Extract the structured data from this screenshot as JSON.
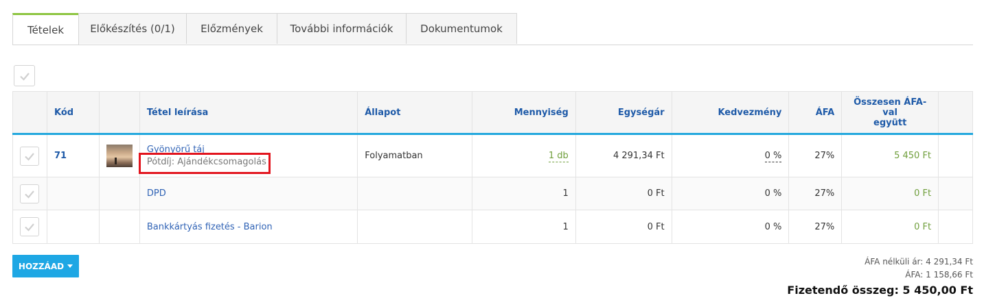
{
  "tabs": [
    {
      "label": "Tételek",
      "active": true
    },
    {
      "label": "Előkészítés (0/1)",
      "active": false
    },
    {
      "label": "Előzmények",
      "active": false
    },
    {
      "label": "További információk",
      "active": false
    },
    {
      "label": "Dokumentumok",
      "active": false
    }
  ],
  "table": {
    "headers": {
      "code": "Kód",
      "description": "Tétel leírása",
      "status": "Állapot",
      "quantity": "Mennyiség",
      "unit_price": "Egységár",
      "discount": "Kedvezmény",
      "vat": "ÁFA",
      "total_line1": "Összesen ÁFA-val",
      "total_line2": "együtt"
    },
    "rows": [
      {
        "code": "71",
        "description": "Gyönyörű táj",
        "surcharge": "Pótdíj: Ajándékcsomagolás",
        "status": "Folyamatban",
        "quantity": "1 db",
        "unit_price": "4 291,34 Ft",
        "discount": "0 %",
        "vat": "27%",
        "total": "5 450 Ft"
      },
      {
        "code": "",
        "description": "DPD",
        "status": "",
        "quantity": "1",
        "unit_price": "0 Ft",
        "discount": "0 %",
        "vat": "27%",
        "total": "0 Ft"
      },
      {
        "code": "",
        "description": "Bankkártyás fizetés - Barion",
        "status": "",
        "quantity": "1",
        "unit_price": "0 Ft",
        "discount": "0 %",
        "vat": "27%",
        "total": "0 Ft"
      }
    ]
  },
  "add_button": {
    "label": "HOZZÁAD"
  },
  "totals": {
    "net": "ÁFA nélküli ár: 4 291,34 Ft",
    "vat": "ÁFA: 1 158,66 Ft",
    "grand": "Fizetendő összeg: 5 450,00 Ft"
  },
  "colors": {
    "accent_blue": "#1ea7e4",
    "active_tab_border": "#8cc43f",
    "header_text": "#1e5aa8",
    "total_green": "#6f9e3b",
    "highlight_red": "#e2141d"
  },
  "icons": {
    "checkbox": "check-icon",
    "dropdown": "caret-down-icon"
  }
}
